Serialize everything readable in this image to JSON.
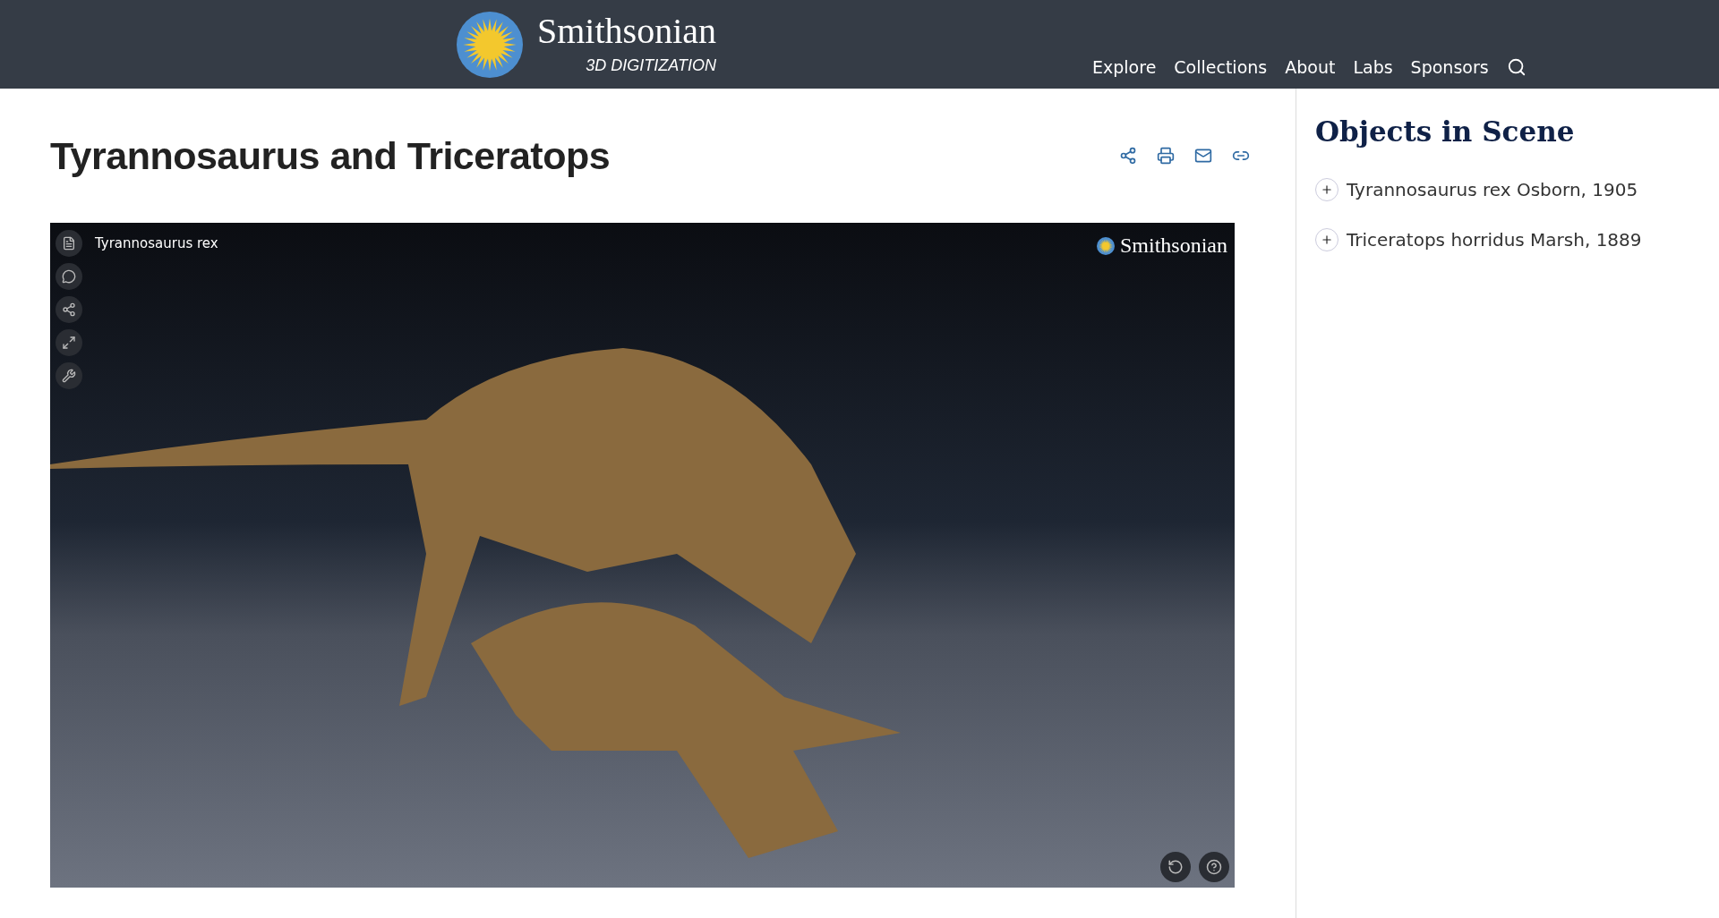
{
  "header": {
    "logo_title": "Smithsonian",
    "logo_subtitle": "3D DIGITIZATION",
    "nav": [
      "Explore",
      "Collections",
      "About",
      "Labs",
      "Sponsors"
    ]
  },
  "page": {
    "title": "Tyrannosaurus and Triceratops"
  },
  "viewer": {
    "object_label": "Tyrannosaurus rex",
    "brand": "Smithsonian"
  },
  "sidebar": {
    "title": "Objects in Scene",
    "items": [
      {
        "label": "Tyrannosaurus rex Osborn, 1905",
        "expanded": false
      },
      {
        "label": "Triceratops horridus Marsh, 1889",
        "expanded": false
      }
    ]
  }
}
